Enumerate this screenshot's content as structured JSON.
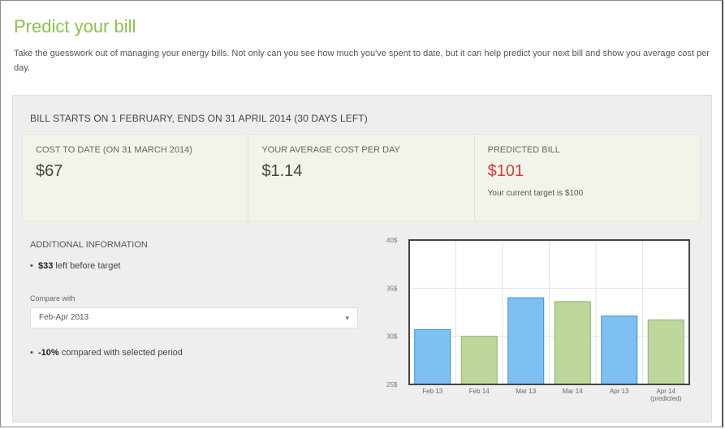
{
  "page": {
    "title": "Predict your bill",
    "intro": "Take the guesswork out of managing your energy bills. Not only can you see how much you've spent to date, but it can help predict your next bill and show you average cost per day."
  },
  "bill": {
    "header": "BILL STARTS ON 1 FEBRUARY, ENDS ON 31 APRIL 2014 (30 DAYS LEFT)",
    "stats": [
      {
        "label": "COST TO DATE (ON 31 MARCH 2014)",
        "value": "$67"
      },
      {
        "label": "YOUR AVERAGE COST PER DAY",
        "value": "$1.14"
      },
      {
        "label": "PREDICTED BILL",
        "value": "$101",
        "note": "Your current target is $100"
      }
    ]
  },
  "additional": {
    "heading": "ADDITIONAL INFORMATION",
    "left_amount": "$33",
    "left_text": " left before target",
    "compare_label": "Compare with",
    "compare_selected": "Feb-Apr 2013",
    "diff_amount": "-10%",
    "diff_text": " compared with selected period"
  },
  "colors": {
    "title": "#8cc14c",
    "predicted": "#d9363e",
    "bar_blue": "#7ec0f2",
    "bar_green": "#bcd69b"
  },
  "chart_data": {
    "type": "bar",
    "categories": [
      "Feb 13",
      "Feb 14",
      "Mar 13",
      "Mar 14",
      "Apr 13",
      "Apr 14"
    ],
    "category_sublabels": [
      "",
      "",
      "",
      "",
      "",
      "(predicted)"
    ],
    "values": [
      30.7,
      30,
      34,
      33.6,
      32.1,
      31.7
    ],
    "bar_colors": [
      "blue",
      "green",
      "blue",
      "green",
      "blue",
      "green"
    ],
    "yticks": [
      "25$",
      "30$",
      "35$",
      "40$"
    ],
    "ylim": [
      25,
      40
    ],
    "title": "",
    "xlabel": "",
    "ylabel": ""
  }
}
